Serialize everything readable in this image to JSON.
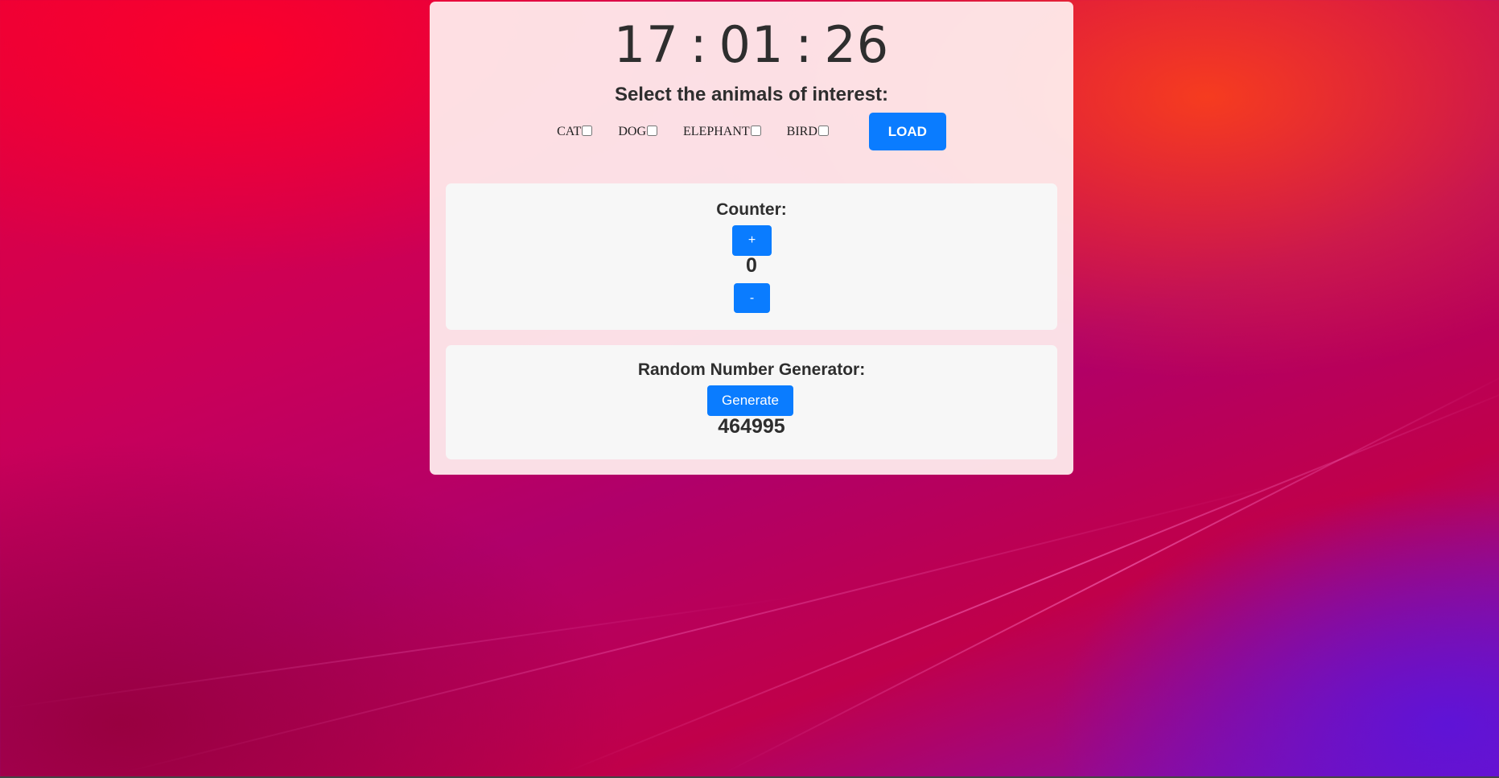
{
  "clock": {
    "hours": "17",
    "minutes": "01",
    "seconds": "26",
    "separator": ":"
  },
  "animals": {
    "title": "Select the animals of interest:",
    "options": [
      {
        "label": "CAT",
        "checked": false
      },
      {
        "label": "DOG",
        "checked": false
      },
      {
        "label": "ELEPHANT",
        "checked": false
      },
      {
        "label": "BIRD",
        "checked": false
      }
    ],
    "load_label": "LOAD"
  },
  "counter": {
    "title": "Counter:",
    "increment_label": "+",
    "value": "0",
    "decrement_label": "-"
  },
  "random": {
    "title": "Random Number Generator:",
    "generate_label": "Generate",
    "value": "464995"
  },
  "colors": {
    "accent": "#0a7cff",
    "card_bg": "#ffeeee",
    "panel_bg": "#f7f7f7",
    "text": "#2e2e2e"
  }
}
